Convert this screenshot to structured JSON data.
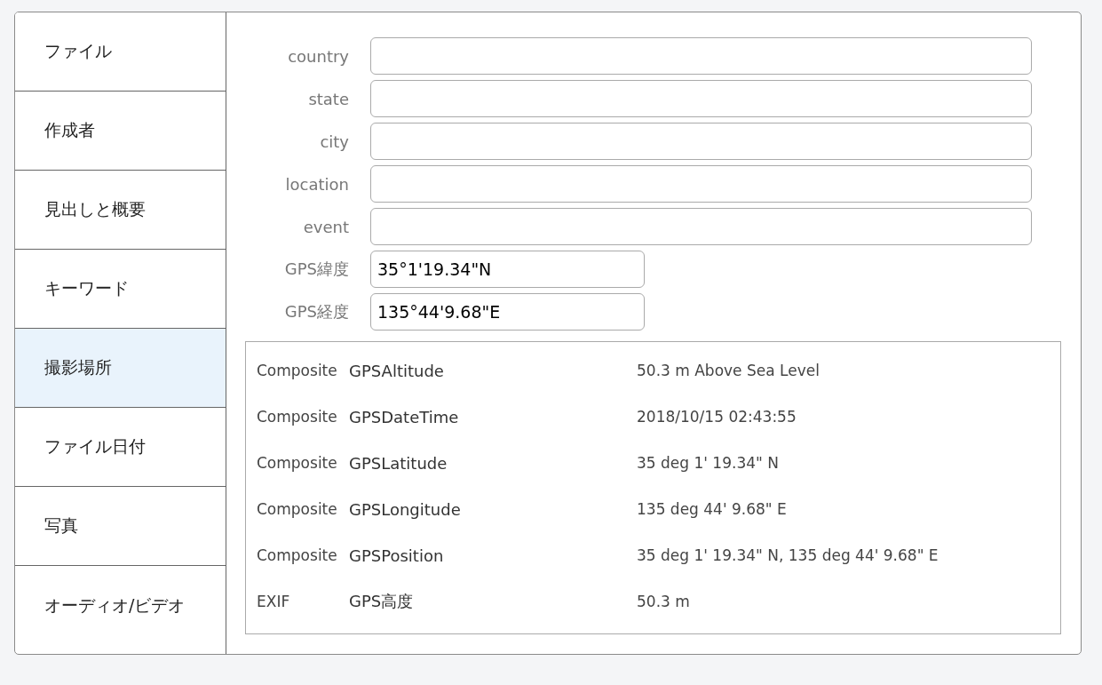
{
  "sidebar": {
    "items": [
      {
        "label": "ファイル",
        "selected": false
      },
      {
        "label": "作成者",
        "selected": false
      },
      {
        "label": "見出しと概要",
        "selected": false
      },
      {
        "label": "キーワード",
        "selected": false
      },
      {
        "label": "撮影場所",
        "selected": true
      },
      {
        "label": "ファイル日付",
        "selected": false
      },
      {
        "label": "写真",
        "selected": false
      },
      {
        "label": "オーディオ/ビデオ",
        "selected": false
      }
    ]
  },
  "form": {
    "fields": [
      {
        "label": "country",
        "kind": "wide"
      },
      {
        "label": "state",
        "kind": "wide"
      },
      {
        "label": "city",
        "kind": "wide"
      },
      {
        "label": "location",
        "kind": "wide"
      },
      {
        "label": "event",
        "kind": "wide"
      },
      {
        "label": "GPS緯度",
        "kind": "short",
        "value": "35°1'19.34\"N"
      },
      {
        "label": "GPS経度",
        "kind": "short",
        "value": "135°44'9.68\"E"
      }
    ]
  },
  "metadata_table": {
    "rows": [
      {
        "group": "Composite",
        "tag": "GPSAltitude",
        "value": "50.3 m Above Sea Level"
      },
      {
        "group": "Composite",
        "tag": "GPSDateTime",
        "value": "2018/10/15 02:43:55"
      },
      {
        "group": "Composite",
        "tag": "GPSLatitude",
        "value": "35 deg 1' 19.34\" N"
      },
      {
        "group": "Composite",
        "tag": "GPSLongitude",
        "value": "135 deg 44' 9.68\" E"
      },
      {
        "group": "Composite",
        "tag": "GPSPosition",
        "value": "35 deg 1' 19.34\" N, 135 deg 44' 9.68\" E"
      },
      {
        "group": "EXIF",
        "tag": "GPS高度",
        "value": "50.3 m"
      }
    ]
  }
}
